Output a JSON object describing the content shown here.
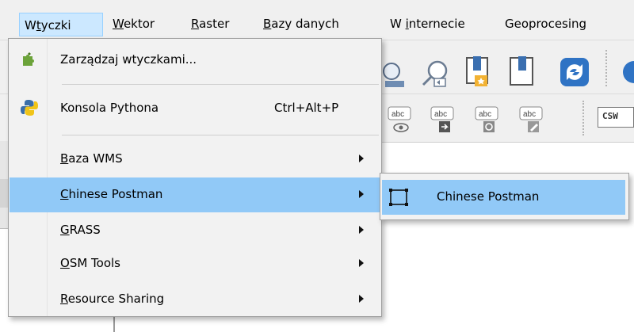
{
  "menubar": {
    "items": [
      {
        "pre": "W",
        "ul": "t",
        "post": "yczki"
      },
      {
        "pre": "",
        "ul": "W",
        "post": "ektor"
      },
      {
        "pre": "",
        "ul": "R",
        "post": "aster"
      },
      {
        "pre": "",
        "ul": "B",
        "post": "azy danych"
      },
      {
        "pre": "W ",
        "ul": "i",
        "post": "nternecie"
      },
      {
        "pre": "",
        "ul": "",
        "post": "Geoprocesing"
      }
    ]
  },
  "toolbar": {
    "csw_label": "CSW",
    "abc_label": "abc"
  },
  "dropdown": {
    "items": [
      {
        "label": "Zarządzaj wtyczkami...",
        "icon": "plugin-manager-icon"
      },
      {
        "label": "Konsola Pythona",
        "shortcut": "Ctrl+Alt+P",
        "icon": "python-icon"
      },
      {
        "pre": "",
        "ul": "B",
        "post": "aza WMS"
      },
      {
        "pre": "",
        "ul": "C",
        "post": "hinese Postman"
      },
      {
        "pre": "",
        "ul": "G",
        "post": "RASS"
      },
      {
        "pre": "",
        "ul": "O",
        "post": "SM Tools"
      },
      {
        "pre": "",
        "ul": "R",
        "post": "esource Sharing"
      }
    ]
  },
  "submenu": {
    "items": [
      {
        "label": "Chinese Postman",
        "icon": "chinese-postman-icon"
      }
    ]
  },
  "colors": {
    "highlight": "#91c9f7",
    "menu_bg": "#f2f2f2",
    "active_menu": "#cce8ff"
  }
}
